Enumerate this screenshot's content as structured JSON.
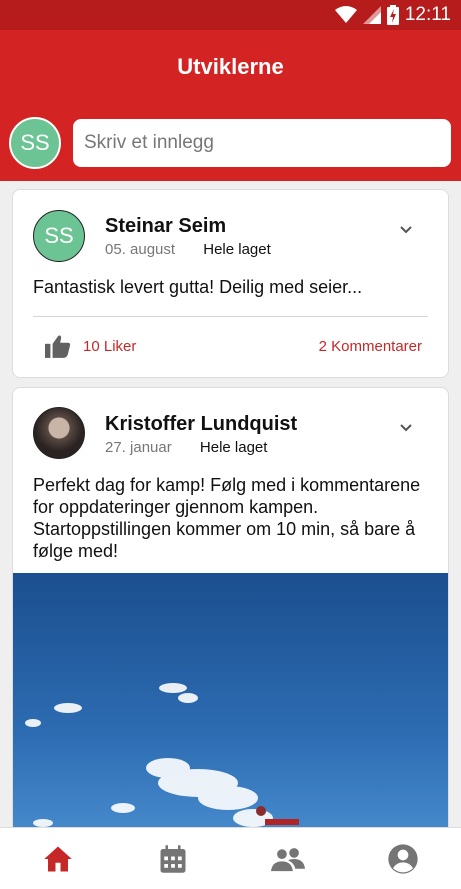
{
  "status_bar": {
    "time": "12:11",
    "icons": [
      "wifi-icon",
      "signal-icon",
      "battery-icon"
    ]
  },
  "app_bar": {
    "title": "Utviklerne"
  },
  "compose": {
    "avatar_initials": "SS",
    "placeholder": "Skriv et innlegg"
  },
  "posts": [
    {
      "author": "Steinar Seim",
      "avatar_initials": "SS",
      "date": "05. august",
      "audience": "Hele laget",
      "text": "Fantastisk levert gutta! Deilig med seier...",
      "likes_label": "10 Liker",
      "comments_label": "2 Kommentarer"
    },
    {
      "author": "Kristoffer Lundquist",
      "date": "27. januar",
      "audience": "Hele laget",
      "text": "Perfekt dag for kamp! Følg med i kommentarene for oppdateringer gjennom kampen. Startoppstillingen kommer om 10 min, så bare å følge med!"
    }
  ],
  "bottom_nav": {
    "items": [
      "home-icon",
      "calendar-icon",
      "people-icon",
      "account-icon"
    ],
    "active": "home-icon"
  },
  "colors": {
    "primary": "#d32323",
    "status_bar": "#b71c1c",
    "accent_text": "#c62828",
    "avatar": "#6cc393"
  }
}
